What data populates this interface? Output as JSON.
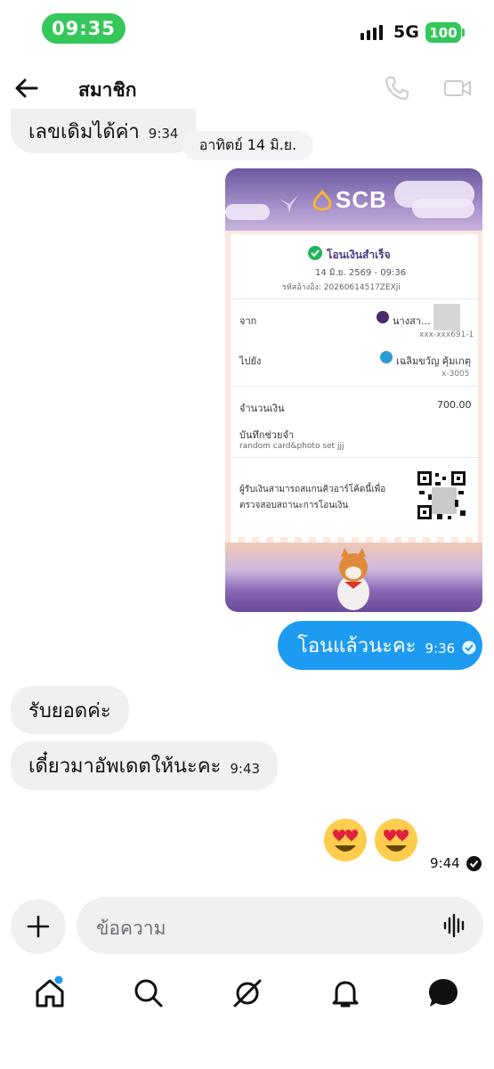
{
  "status_bar": {
    "time": "09:35",
    "network": "5G",
    "battery": "100"
  },
  "header": {
    "title": "สมาชิก",
    "back_icon": "arrow-left-icon",
    "call_icon": "phone-icon",
    "video_icon": "video-camera-icon"
  },
  "messages": [
    {
      "side": "in",
      "text": "เลขเดิมได้ค่า",
      "time": "9:34"
    },
    {
      "side": "separator",
      "text": "อาทิตย์ 14 มิ.ย."
    },
    {
      "side": "out",
      "type": "image",
      "slip": {
        "bank": "SCB",
        "status": "โอนเงินสำเร็จ",
        "datetime": "14 มิ.ย. 2569 - 09:36",
        "ref": "รหัสอ้างอิง: 2026061451​7ZEXji",
        "from_label": "จาก",
        "from_name": "นางสา... ...า.",
        "from_account": "xxx-xxx691-1",
        "to_label": "ไปยัง",
        "to_name": "เฉลิมขวัญ คุ้มเกตุ",
        "to_account": "x-3005",
        "amount_label": "จำนวนเงิน",
        "amount": "700.00",
        "memo_label": "บันทึกช่วยจำ",
        "memo": "random card&photo set jjj",
        "qr_note_line1": "ผู้รับเงินสามารถสแกนคิวอาร์โค้ดนี้เพื่อ",
        "qr_note_line2": "ตรวจสอบสถานะการโอนเงิน"
      }
    },
    {
      "side": "out",
      "text": "โอนแล้วนะคะ",
      "time": "9:36"
    },
    {
      "side": "in",
      "text": "รับยอดค่ะ"
    },
    {
      "side": "in",
      "text": "เดี๋ยวมาอัพเดตให้นะคะ",
      "time": "9:43"
    },
    {
      "side": "out",
      "type": "emoji",
      "emoji": [
        "😍",
        "😍"
      ],
      "time": "9:44"
    }
  ],
  "composer": {
    "placeholder": "ข้อความ",
    "add_icon": "plus-icon",
    "voice_icon": "voice-waveform-icon"
  },
  "bottom_nav": [
    "home-icon",
    "search-icon",
    "grok-icon",
    "bell-icon",
    "messages-icon"
  ],
  "colors": {
    "accent": "#1d9bf0",
    "status_green": "#34c759",
    "bubble_in": "#eef0f2",
    "slip_purple": "#6d5aa1"
  }
}
